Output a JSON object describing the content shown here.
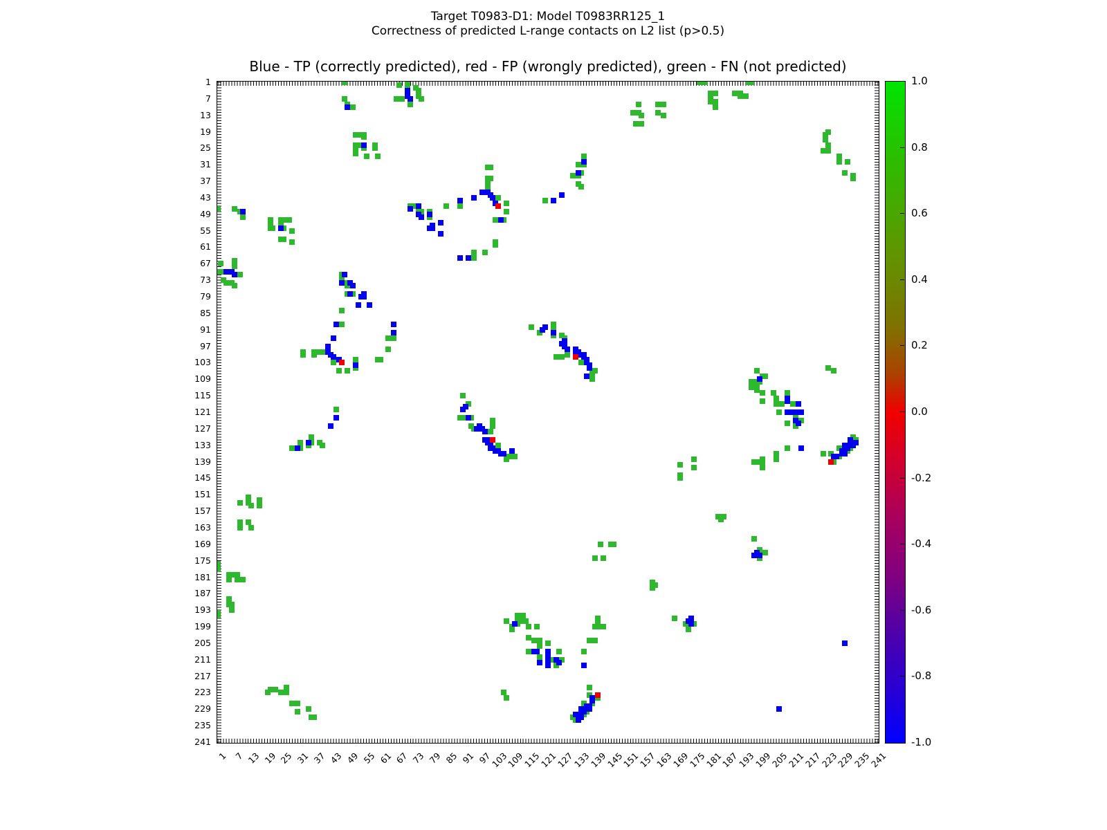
{
  "header": {
    "title_line1": "Target T0983-D1: Model T0983RR125_1",
    "title_line2": "Correctness of predicted L-range contacts on L2 list (p>0.5)"
  },
  "chart_data": {
    "type": "heatmap",
    "title": "Target T0983-D1: Model T0983RR125_1",
    "subtitle": "Correctness of predicted L-range contacts on L2 list (p>0.5)",
    "axes_title": "Blue - TP (correctly predicted), red - FP (wrongly predicted), green - FN (not predicted)",
    "legend": {
      "TP": "blue = correctly predicted",
      "FP": "red = wrongly predicted",
      "FN": "green = not predicted"
    },
    "axis_range": [
      0.5,
      241.5
    ],
    "grid": false,
    "symmetric": true,
    "x_ticks": [
      1,
      7,
      13,
      19,
      25,
      31,
      37,
      43,
      49,
      55,
      61,
      67,
      73,
      79,
      85,
      91,
      97,
      103,
      109,
      115,
      121,
      127,
      133,
      139,
      145,
      151,
      157,
      163,
      169,
      175,
      181,
      187,
      193,
      199,
      205,
      211,
      217,
      223,
      229,
      235,
      241
    ],
    "y_ticks": [
      1,
      7,
      13,
      19,
      25,
      31,
      37,
      43,
      49,
      55,
      61,
      67,
      73,
      79,
      85,
      91,
      97,
      103,
      109,
      115,
      121,
      127,
      133,
      139,
      145,
      151,
      157,
      163,
      169,
      175,
      181,
      187,
      193,
      199,
      205,
      211,
      217,
      223,
      229,
      235,
      241
    ],
    "colors": {
      "T": "#0000ee",
      "F": "#ee0000",
      "N": "#2eb82e"
    },
    "colorbar": {
      "vmin": -1.0,
      "vmax": 1.0,
      "tick_labels": [
        "1.0",
        "0.8",
        "0.6",
        "0.4",
        "0.2",
        "0.0",
        "-0.2",
        "-0.4",
        "-0.6",
        "-0.8",
        "-1.0"
      ],
      "gradient_meaning": "green=+1 (FN), red=0 (FP), blue=-1 (TP)"
    },
    "points": [
      [
        67,
        2,
        "N"
      ],
      [
        70,
        1,
        "N"
      ],
      [
        70,
        2,
        "N"
      ],
      [
        73,
        3,
        "N"
      ],
      [
        74,
        4,
        "N"
      ],
      [
        70,
        4,
        "T"
      ],
      [
        66,
        7,
        "N"
      ],
      [
        68,
        7,
        "N"
      ],
      [
        70,
        6,
        "T"
      ],
      [
        71,
        7,
        "T"
      ],
      [
        74,
        6,
        "N"
      ],
      [
        75,
        7,
        "N"
      ],
      [
        71,
        9,
        "N"
      ],
      [
        47,
        1,
        "N"
      ],
      [
        47,
        7,
        "N"
      ],
      [
        48,
        9,
        "N"
      ],
      [
        48,
        10,
        "T"
      ],
      [
        50,
        10,
        "N"
      ],
      [
        51,
        20,
        "N"
      ],
      [
        52,
        20,
        "N"
      ],
      [
        54,
        20,
        "N"
      ],
      [
        54,
        21,
        "N"
      ],
      [
        51,
        24,
        "N"
      ],
      [
        52,
        24,
        "N"
      ],
      [
        53,
        24,
        "N"
      ],
      [
        54,
        24,
        "T"
      ],
      [
        51,
        25,
        "N"
      ],
      [
        54,
        25,
        "N"
      ],
      [
        51,
        27,
        "N"
      ],
      [
        55,
        28,
        "N"
      ],
      [
        58,
        24,
        "N"
      ],
      [
        58,
        25,
        "N"
      ],
      [
        59,
        28,
        "N"
      ],
      [
        134,
        28,
        "N"
      ],
      [
        134,
        30,
        "T"
      ],
      [
        132,
        31,
        "N"
      ],
      [
        134,
        31,
        "N"
      ],
      [
        132,
        34,
        "T"
      ],
      [
        133,
        34,
        "N"
      ],
      [
        130,
        35,
        "N"
      ],
      [
        132,
        35,
        "N"
      ],
      [
        132,
        38,
        "N"
      ],
      [
        133,
        39,
        "N"
      ],
      [
        120,
        44,
        "N"
      ],
      [
        123,
        44,
        "T"
      ],
      [
        126,
        42,
        "T"
      ],
      [
        71,
        46,
        "N"
      ],
      [
        72,
        46,
        "N"
      ],
      [
        71,
        47,
        "T"
      ],
      [
        74,
        46,
        "T"
      ],
      [
        74,
        48,
        "N"
      ],
      [
        75,
        48,
        "N"
      ],
      [
        74,
        49,
        "T"
      ],
      [
        75,
        50,
        "T"
      ],
      [
        78,
        48,
        "N"
      ],
      [
        78,
        49,
        "T"
      ],
      [
        78,
        50,
        "N"
      ],
      [
        79,
        53,
        "T"
      ],
      [
        78,
        54,
        "T"
      ],
      [
        79,
        54,
        "T"
      ],
      [
        82,
        52,
        "T"
      ],
      [
        82,
        56,
        "T"
      ],
      [
        84,
        46,
        "N"
      ],
      [
        99,
        32,
        "N"
      ],
      [
        100,
        32,
        "N"
      ],
      [
        99,
        36,
        "N"
      ],
      [
        100,
        36,
        "N"
      ],
      [
        99,
        38,
        "N"
      ],
      [
        99,
        39,
        "N"
      ],
      [
        89,
        44,
        "T"
      ],
      [
        89,
        46,
        "N"
      ],
      [
        94,
        43,
        "T"
      ],
      [
        97,
        41,
        "T"
      ],
      [
        98,
        41,
        "T"
      ],
      [
        99,
        41,
        "T"
      ],
      [
        100,
        42,
        "T"
      ],
      [
        101,
        43,
        "T"
      ],
      [
        103,
        43,
        "N"
      ],
      [
        102,
        45,
        "T"
      ],
      [
        103,
        46,
        "F"
      ],
      [
        106,
        45,
        "N"
      ],
      [
        106,
        48,
        "N"
      ],
      [
        102,
        51,
        "N"
      ],
      [
        104,
        51,
        "T"
      ],
      [
        105,
        51,
        "N"
      ],
      [
        102,
        59,
        "N"
      ],
      [
        102,
        60,
        "N"
      ],
      [
        94,
        63,
        "N"
      ],
      [
        98,
        63,
        "N"
      ],
      [
        89,
        65,
        "T"
      ],
      [
        92,
        65,
        "T"
      ],
      [
        94,
        65,
        "N"
      ],
      [
        154,
        9,
        "N"
      ],
      [
        161,
        9,
        "N"
      ],
      [
        163,
        9,
        "N"
      ],
      [
        152,
        12,
        "N"
      ],
      [
        154,
        12,
        "N"
      ],
      [
        155,
        13,
        "N"
      ],
      [
        161,
        12,
        "N"
      ],
      [
        163,
        13,
        "N"
      ],
      [
        153,
        16,
        "N"
      ],
      [
        155,
        16,
        "N"
      ],
      [
        176,
        1,
        "N"
      ],
      [
        178,
        1,
        "N"
      ],
      [
        194,
        1,
        "N"
      ],
      [
        195,
        1,
        "N"
      ],
      [
        180,
        5,
        "N"
      ],
      [
        180,
        6,
        "N"
      ],
      [
        182,
        5,
        "N"
      ],
      [
        180,
        8,
        "N"
      ],
      [
        182,
        8,
        "N"
      ],
      [
        182,
        9,
        "N"
      ],
      [
        182,
        10,
        "N"
      ],
      [
        189,
        5,
        "N"
      ],
      [
        191,
        5,
        "N"
      ],
      [
        191,
        6,
        "N"
      ],
      [
        193,
        6,
        "N"
      ],
      [
        223,
        19,
        "N"
      ],
      [
        222,
        20,
        "N"
      ],
      [
        222,
        22,
        "N"
      ],
      [
        223,
        24,
        "N"
      ],
      [
        221,
        26,
        "N"
      ],
      [
        223,
        26,
        "N"
      ],
      [
        227,
        28,
        "N"
      ],
      [
        227,
        30,
        "N"
      ],
      [
        230,
        30,
        "N"
      ],
      [
        229,
        34,
        "N"
      ],
      [
        232,
        35,
        "N"
      ],
      [
        232,
        36,
        "N"
      ],
      [
        115,
        90,
        "N"
      ],
      [
        120,
        90,
        "T"
      ],
      [
        119,
        91,
        "T"
      ],
      [
        118,
        92,
        "N"
      ],
      [
        123,
        89,
        "N"
      ],
      [
        123,
        90,
        "N"
      ],
      [
        123,
        92,
        "T"
      ],
      [
        123,
        93,
        "N"
      ],
      [
        126,
        93,
        "N"
      ],
      [
        127,
        94,
        "N"
      ],
      [
        127,
        95,
        "T"
      ],
      [
        126,
        96,
        "T"
      ],
      [
        127,
        97,
        "T"
      ],
      [
        128,
        98,
        "T"
      ],
      [
        128,
        99,
        "N"
      ],
      [
        128,
        100,
        "N"
      ],
      [
        124,
        101,
        "N"
      ],
      [
        126,
        101,
        "N"
      ],
      [
        131,
        98,
        "T"
      ],
      [
        131,
        99,
        "T"
      ],
      [
        131,
        101,
        "F"
      ],
      [
        132,
        99,
        "T"
      ],
      [
        133,
        100,
        "T"
      ],
      [
        134,
        100,
        "T"
      ],
      [
        134,
        101,
        "T"
      ],
      [
        135,
        102,
        "T"
      ],
      [
        133,
        103,
        "N"
      ],
      [
        135,
        103,
        "T"
      ],
      [
        136,
        104,
        "T"
      ],
      [
        136,
        105,
        "T"
      ],
      [
        137,
        106,
        "N"
      ],
      [
        138,
        106,
        "N"
      ],
      [
        137,
        107,
        "N"
      ],
      [
        137,
        108,
        "N"
      ],
      [
        135,
        108,
        "T"
      ],
      [
        137,
        109,
        "N"
      ],
      [
        197,
        106,
        "N"
      ],
      [
        199,
        108,
        "N"
      ],
      [
        200,
        108,
        "N"
      ],
      [
        198,
        109,
        "T"
      ],
      [
        195,
        110,
        "N"
      ],
      [
        196,
        110,
        "N"
      ],
      [
        197,
        110,
        "N"
      ],
      [
        198,
        110,
        "N"
      ],
      [
        197,
        111,
        "N"
      ],
      [
        195,
        112,
        "N"
      ],
      [
        197,
        112,
        "N"
      ],
      [
        197,
        113,
        "N"
      ],
      [
        199,
        114,
        "N"
      ],
      [
        203,
        114,
        "N"
      ],
      [
        208,
        114,
        "N"
      ],
      [
        199,
        117,
        "N"
      ],
      [
        204,
        116,
        "N"
      ],
      [
        204,
        118,
        "N"
      ],
      [
        206,
        118,
        "N"
      ],
      [
        208,
        116,
        "T"
      ],
      [
        208,
        117,
        "T"
      ],
      [
        210,
        118,
        "N"
      ],
      [
        212,
        118,
        "T"
      ],
      [
        205,
        121,
        "N"
      ],
      [
        208,
        121,
        "T"
      ],
      [
        209,
        121,
        "T"
      ],
      [
        211,
        121,
        "T"
      ],
      [
        213,
        121,
        "T"
      ],
      [
        211,
        122,
        "N"
      ],
      [
        208,
        125,
        "N"
      ],
      [
        211,
        124,
        "T"
      ],
      [
        212,
        125,
        "T"
      ],
      [
        213,
        124,
        "N"
      ],
      [
        211,
        126,
        "N"
      ],
      [
        208,
        134,
        "N"
      ],
      [
        213,
        134,
        "T"
      ],
      [
        204,
        136,
        "N"
      ],
      [
        204,
        138,
        "N"
      ],
      [
        196,
        139,
        "N"
      ],
      [
        197,
        139,
        "N"
      ],
      [
        198,
        139,
        "N"
      ],
      [
        199,
        138,
        "N"
      ],
      [
        199,
        140,
        "N"
      ],
      [
        199,
        141,
        "N"
      ],
      [
        223,
        105,
        "N"
      ],
      [
        225,
        106,
        "N"
      ],
      [
        169,
        140,
        "N"
      ],
      [
        174,
        138,
        "N"
      ],
      [
        174,
        141,
        "N"
      ],
      [
        169,
        144,
        "N"
      ],
      [
        169,
        145,
        "N"
      ],
      [
        183,
        159,
        "N"
      ],
      [
        184,
        159,
        "N"
      ],
      [
        185,
        159,
        "N"
      ],
      [
        184,
        160,
        "N"
      ],
      [
        196,
        167,
        "N"
      ],
      [
        198,
        171,
        "N"
      ],
      [
        197,
        172,
        "T"
      ],
      [
        199,
        172,
        "N"
      ],
      [
        200,
        172,
        "N"
      ],
      [
        196,
        173,
        "T"
      ],
      [
        197,
        173,
        "T"
      ],
      [
        198,
        173,
        "T"
      ],
      [
        198,
        174,
        "N"
      ],
      [
        221,
        136,
        "N"
      ],
      [
        224,
        136,
        "N"
      ],
      [
        224,
        139,
        "F"
      ],
      [
        225,
        139,
        "N"
      ],
      [
        225,
        137,
        "T"
      ],
      [
        226,
        137,
        "T"
      ],
      [
        227,
        137,
        "N"
      ],
      [
        227,
        134,
        "N"
      ],
      [
        228,
        135,
        "T"
      ],
      [
        228,
        136,
        "T"
      ],
      [
        229,
        136,
        "T"
      ],
      [
        229,
        135,
        "N"
      ],
      [
        230,
        135,
        "N"
      ],
      [
        229,
        133,
        "T"
      ],
      [
        230,
        133,
        "T"
      ],
      [
        230,
        134,
        "T"
      ],
      [
        231,
        134,
        "N"
      ],
      [
        231,
        131,
        "T"
      ],
      [
        232,
        132,
        "T"
      ],
      [
        232,
        133,
        "T"
      ],
      [
        232,
        130,
        "N"
      ],
      [
        233,
        131,
        "N"
      ],
      [
        233,
        132,
        "T"
      ],
      [
        229,
        205,
        "T"
      ]
    ]
  },
  "layout_text": {
    "note": "contact map, residue vs residue, symmetric about diagonal"
  }
}
